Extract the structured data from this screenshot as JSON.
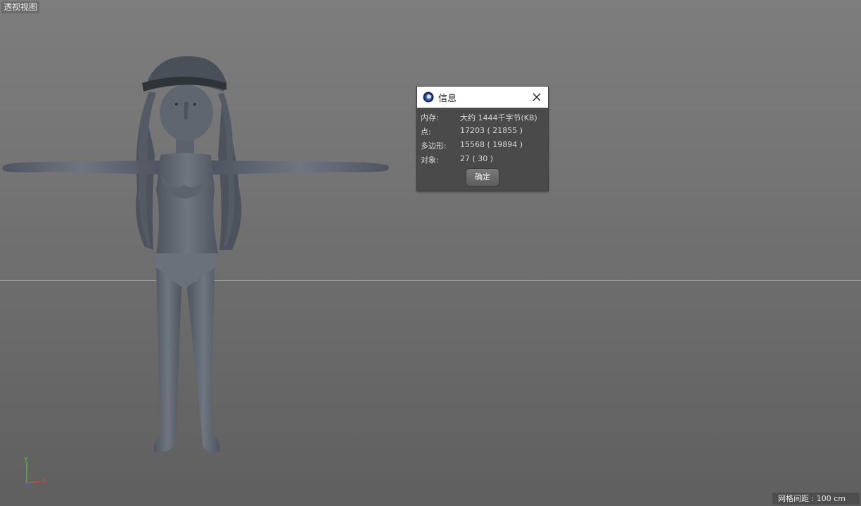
{
  "viewport": {
    "label": "透视视图"
  },
  "dialog": {
    "title": "信息",
    "icon": "cinema4d-logo-icon",
    "rows": [
      {
        "key": "内存:",
        "value": "大约 1444千字节(KB)"
      },
      {
        "key": "点:",
        "value": "17203 ( 21855 )"
      },
      {
        "key": "多边形:",
        "value": "15568 ( 19894 )"
      },
      {
        "key": "对象:",
        "value": "27 ( 30 )"
      }
    ],
    "ok_label": "确定",
    "close_icon": "close-icon"
  },
  "axis": {
    "y": "Y",
    "z": "Z",
    "x": "X"
  },
  "status": {
    "grid_spacing": "网格间距 : 100 cm"
  },
  "colors": {
    "x_axis": "#d24a3c",
    "y_axis": "#5fc04a",
    "z_axis": "#4a5fd2"
  }
}
